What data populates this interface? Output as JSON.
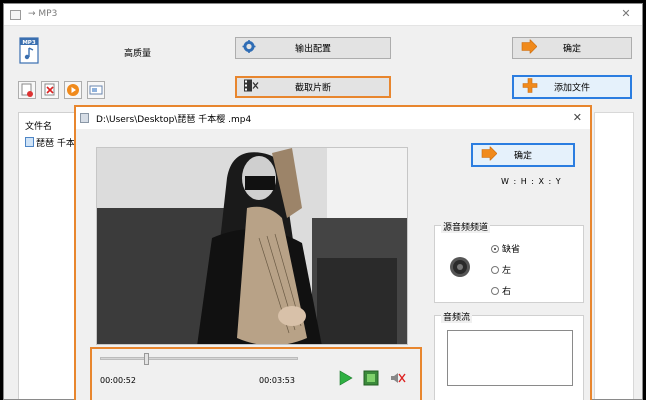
{
  "window": {
    "title": "→ MP3"
  },
  "toolbar": {
    "quality_label": "高质量",
    "output_config_label": "输出配置",
    "confirm_label": "确定",
    "clip_label": "截取片断",
    "add_file_label": "添加文件",
    "mp3_icon_text": "MP3"
  },
  "file_list": {
    "header": "文件名",
    "items": [
      {
        "name": "琵琶 千本"
      }
    ]
  },
  "dialog": {
    "title": "D:\\Users\\Desktop\\琵琶 千本樱 .mp4",
    "confirm_label": "确定",
    "wh_label": "W : H : X : Y",
    "channel_group": {
      "title": "源音频频道",
      "options": [
        "缺省",
        "左",
        "右"
      ],
      "selected": "缺省"
    },
    "stream_group": {
      "title": "音频流"
    },
    "player": {
      "current_time": "00:00:52",
      "total_time": "00:03:53",
      "progress": 0.223
    }
  },
  "colors": {
    "highlight_orange": "#e8862e",
    "highlight_blue": "#2b7de0",
    "accent_arrow": "#f08a1c"
  }
}
